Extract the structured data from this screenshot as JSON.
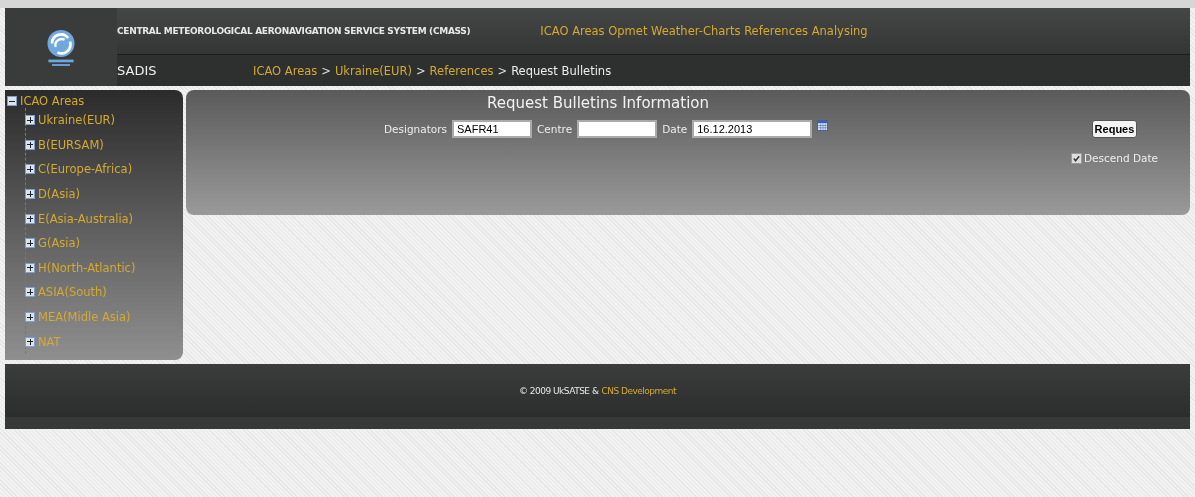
{
  "header": {
    "system_title": "CENTRAL METEOROLOGICAL AERONAVIGATION SERVICE SYSTEM (CMASS)",
    "tagline": "ICAO Areas Opmet Weather-Charts References Analysing",
    "section": "SADIS"
  },
  "breadcrumb": [
    {
      "kind": "link",
      "label": "ICAO Areas"
    },
    {
      "kind": "separator",
      "label": ">"
    },
    {
      "kind": "link",
      "label": "Ukraine(EUR)"
    },
    {
      "kind": "separator",
      "label": ">"
    },
    {
      "kind": "link",
      "label": "References"
    },
    {
      "kind": "separator",
      "label": ">"
    },
    {
      "kind": "current",
      "label": "Request Bulletins"
    }
  ],
  "tree": {
    "label": "ICAO Areas",
    "expanded": true,
    "children": [
      {
        "label": "Ukraine(EUR)",
        "expanded": false
      },
      {
        "label": "B(EURSAM)",
        "expanded": false
      },
      {
        "label": "C(Europe-Africa)",
        "expanded": false
      },
      {
        "label": "D(Asia)",
        "expanded": false
      },
      {
        "label": "E(Asia-Australia)",
        "expanded": false
      },
      {
        "label": "G(Asia)",
        "expanded": false
      },
      {
        "label": "H(North-Atlantic)",
        "expanded": false
      },
      {
        "label": "ASIA(South)",
        "expanded": false
      },
      {
        "label": "MEA(Midle Asia)",
        "expanded": false
      },
      {
        "label": "NAT",
        "expanded": false
      }
    ]
  },
  "form": {
    "title": "Request Bulletins Information",
    "fields": [
      {
        "label": "Designators",
        "value": "SAFR41"
      },
      {
        "label": "Centre"
      },
      {
        "label": "Date",
        "value": "16.12.2013"
      }
    ],
    "button": "Reques",
    "descend": {
      "label": "Descend Date",
      "checked": true
    }
  },
  "footer": {
    "copyright": "© 2009 UkSATSE &",
    "link": "CNS Development"
  }
}
